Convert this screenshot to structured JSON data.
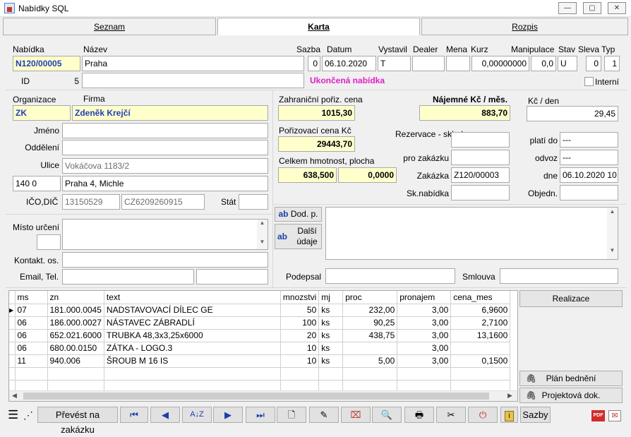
{
  "window": {
    "title": "Nabídky SQL"
  },
  "tabs": [
    {
      "label": "Seznam"
    },
    {
      "label": "Karta"
    },
    {
      "label": "Rozpis"
    }
  ],
  "head": {
    "lbl_nabidka": "Nabídka",
    "lbl_nazev": "Název",
    "lbl_sazba": "Sazba",
    "lbl_datum": "Datum",
    "lbl_vystavil": "Vystavil",
    "lbl_dealer": "Dealer",
    "lbl_mena": "Mena",
    "lbl_kurz": "Kurz",
    "lbl_manipulace": "Manipulace",
    "lbl_stav": "Stav",
    "lbl_sleva": "Sleva",
    "lbl_typ": "Typ",
    "lbl_id": "ID",
    "nabidka": "N120/00005",
    "nazev": "Praha",
    "sazba": "0",
    "datum": "06.10.2020",
    "vystavil": "T",
    "dealer": "",
    "mena": "",
    "kurz": "0,00000000",
    "manipulace": "0,0",
    "stav": "U",
    "sleva": "0",
    "typ": "1",
    "id": "5",
    "status_text": "Ukončená nabídka",
    "interni_label": "Interní"
  },
  "org": {
    "lbl_organizace": "Organizace",
    "lbl_firma": "Firma",
    "lbl_jmeno": "Jméno",
    "lbl_oddeleni": "Oddělení",
    "lbl_ulice": "Ulice",
    "lbl_ico": "IČO,DIČ",
    "lbl_stat": "Stát",
    "lbl_misto": "Místo určení",
    "lbl_kontakt": "Kontakt. os.",
    "lbl_email": "Email, Tel.",
    "organizace": "ZK",
    "firma": "Zdeněk Krejčí",
    "jmeno": "",
    "oddeleni": "",
    "ulice": "Vokáčova 1183/2",
    "psc": "140  0",
    "mesto": "Praha 4, Michle",
    "ico": "13150529",
    "dic": "CZ6209260915",
    "stat": ""
  },
  "prices": {
    "lbl_zahr": "Zahraniční pořiz. cena",
    "lbl_najem": "Nájemné Kč / měs.",
    "lbl_kcden": "Kč / den",
    "lbl_poriz": "Pořizovací cena Kč",
    "lbl_hmot": "Celkem hmotnost, plocha",
    "zahr": "1015,30",
    "najem": "883,70",
    "kcden": "29,45",
    "poriz": "29443,70",
    "hmotnost": "638,500",
    "plocha": "0,0000",
    "lbl_rezervace": "Rezervace - sklad",
    "lbl_prozak": "pro zakázku",
    "lbl_zakazka": "Zakázka",
    "lbl_sknab": "Sk.nabídka",
    "zakazka": "Z120/00003",
    "lbl_platido": "platí do",
    "lbl_odvoz": "odvoz",
    "lbl_dne": "dne",
    "lbl_objedn": "Objedn.",
    "platido": "---",
    "odvoz": "---",
    "dne": "06.10.2020 10"
  },
  "notes": {
    "dod_p": "Dod. p.",
    "dalsi": "Další údaje",
    "lbl_podepsal": "Podepsal",
    "lbl_smlouva": "Smlouva"
  },
  "grid": {
    "columns": [
      "ms",
      "zn",
      "text",
      "mnozstvi",
      "mj",
      "proc",
      "pronajem",
      "cena_mes"
    ],
    "rows": [
      [
        "07",
        "181.000.0045",
        "NADSTAVOVACÍ DÍLEC GE",
        "50",
        "ks",
        "232,00",
        "3,00",
        "6,9600"
      ],
      [
        "06",
        "186.000.0027",
        "NÁSTAVEC ZÁBRADLÍ",
        "100",
        "ks",
        "90,25",
        "3,00",
        "2,7100"
      ],
      [
        "06",
        "652.021.6000",
        "TRUBKA 48,3x3,25x6000",
        "20",
        "ks",
        "438,75",
        "3,00",
        "13,1600"
      ],
      [
        "06",
        "680.00.0150",
        "ZÁTKA - LOGO.3",
        "10",
        "ks",
        "",
        "3,00",
        ""
      ],
      [
        "11",
        "940.006",
        "ŠROUB M 16 IS",
        "10",
        "ks",
        "5,00",
        "3,00",
        "0,1500"
      ]
    ]
  },
  "side": {
    "realizace": "Realizace",
    "plan": "Plán bednění",
    "projekt": "Projektová dok."
  },
  "toolbar": {
    "prevest": "Převést na zakázku",
    "sazby": "Sazby"
  }
}
